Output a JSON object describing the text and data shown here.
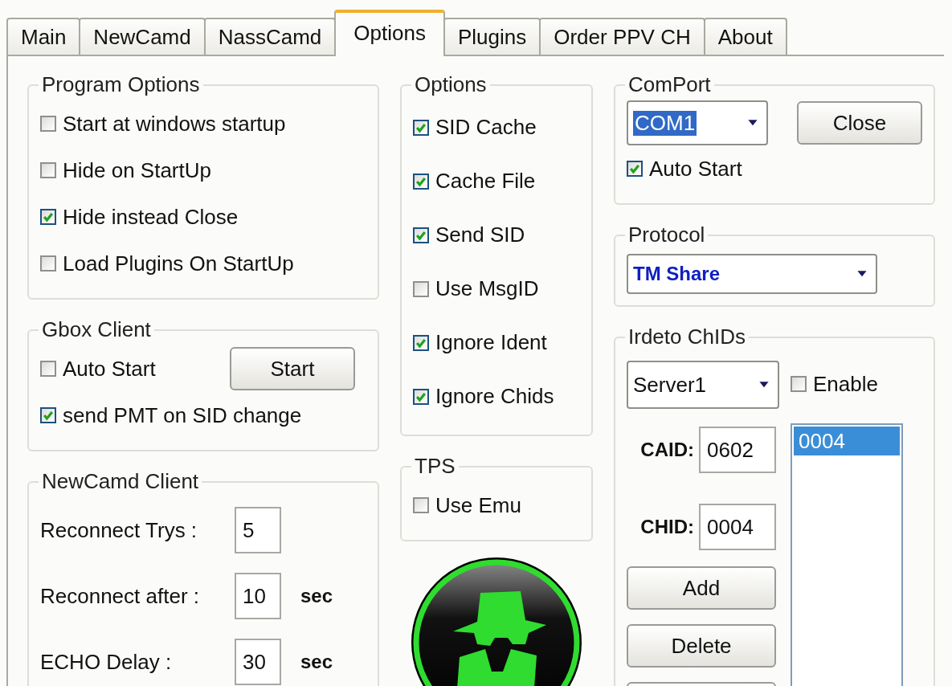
{
  "tabs": [
    {
      "label": "Main",
      "selected": false
    },
    {
      "label": "NewCamd",
      "selected": false
    },
    {
      "label": "NassCamd",
      "selected": false
    },
    {
      "label": "Options",
      "selected": true
    },
    {
      "label": "Plugins",
      "selected": false
    },
    {
      "label": "Order PPV CH",
      "selected": false
    },
    {
      "label": "About",
      "selected": false
    }
  ],
  "program_options": {
    "title": "Program Options",
    "items": [
      {
        "label": "Start at windows startup",
        "checked": false
      },
      {
        "label": "Hide on StartUp",
        "checked": false
      },
      {
        "label": "Hide instead Close",
        "checked": true
      },
      {
        "label": "Load Plugins On StartUp",
        "checked": false
      }
    ]
  },
  "gbox_client": {
    "title": "Gbox Client",
    "auto_start": {
      "label": "Auto Start",
      "checked": false
    },
    "start_button": "Start",
    "send_pmt": {
      "label": "send PMT on SID change",
      "checked": true
    }
  },
  "newcamd_client": {
    "title": "NewCamd Client",
    "rows": [
      {
        "label": "Reconnect Trys :",
        "value": "5"
      },
      {
        "label": "Reconnect after :",
        "value": "10",
        "unit": "sec"
      },
      {
        "label": "ECHO Delay :",
        "value": "30",
        "unit": "sec"
      }
    ]
  },
  "options": {
    "title": "Options",
    "items": [
      {
        "label": "SID Cache",
        "checked": true
      },
      {
        "label": "Cache File",
        "checked": true
      },
      {
        "label": "Send SID",
        "checked": true
      },
      {
        "label": "Use MsgID",
        "checked": false
      },
      {
        "label": "Ignore Ident",
        "checked": true
      },
      {
        "label": "Ignore Chids",
        "checked": true
      }
    ]
  },
  "tps": {
    "title": "TPS",
    "items": [
      {
        "label": "Use Emu",
        "checked": false
      }
    ]
  },
  "comport": {
    "title": "ComPort",
    "port": "COM1",
    "close_button": "Close",
    "auto_start": {
      "label": "Auto Start",
      "checked": true
    }
  },
  "protocol": {
    "title": "Protocol",
    "value": "TM Share"
  },
  "irdeto": {
    "title": "Irdeto ChIDs",
    "server": "Server1",
    "enable": {
      "label": "Enable",
      "checked": false
    },
    "caid": {
      "label": "CAID:",
      "value": "0602"
    },
    "chid": {
      "label": "CHID:",
      "value": "0004"
    },
    "list": [
      {
        "label": "0004",
        "selected": true
      }
    ],
    "buttons": [
      "Add",
      "Delete"
    ]
  }
}
